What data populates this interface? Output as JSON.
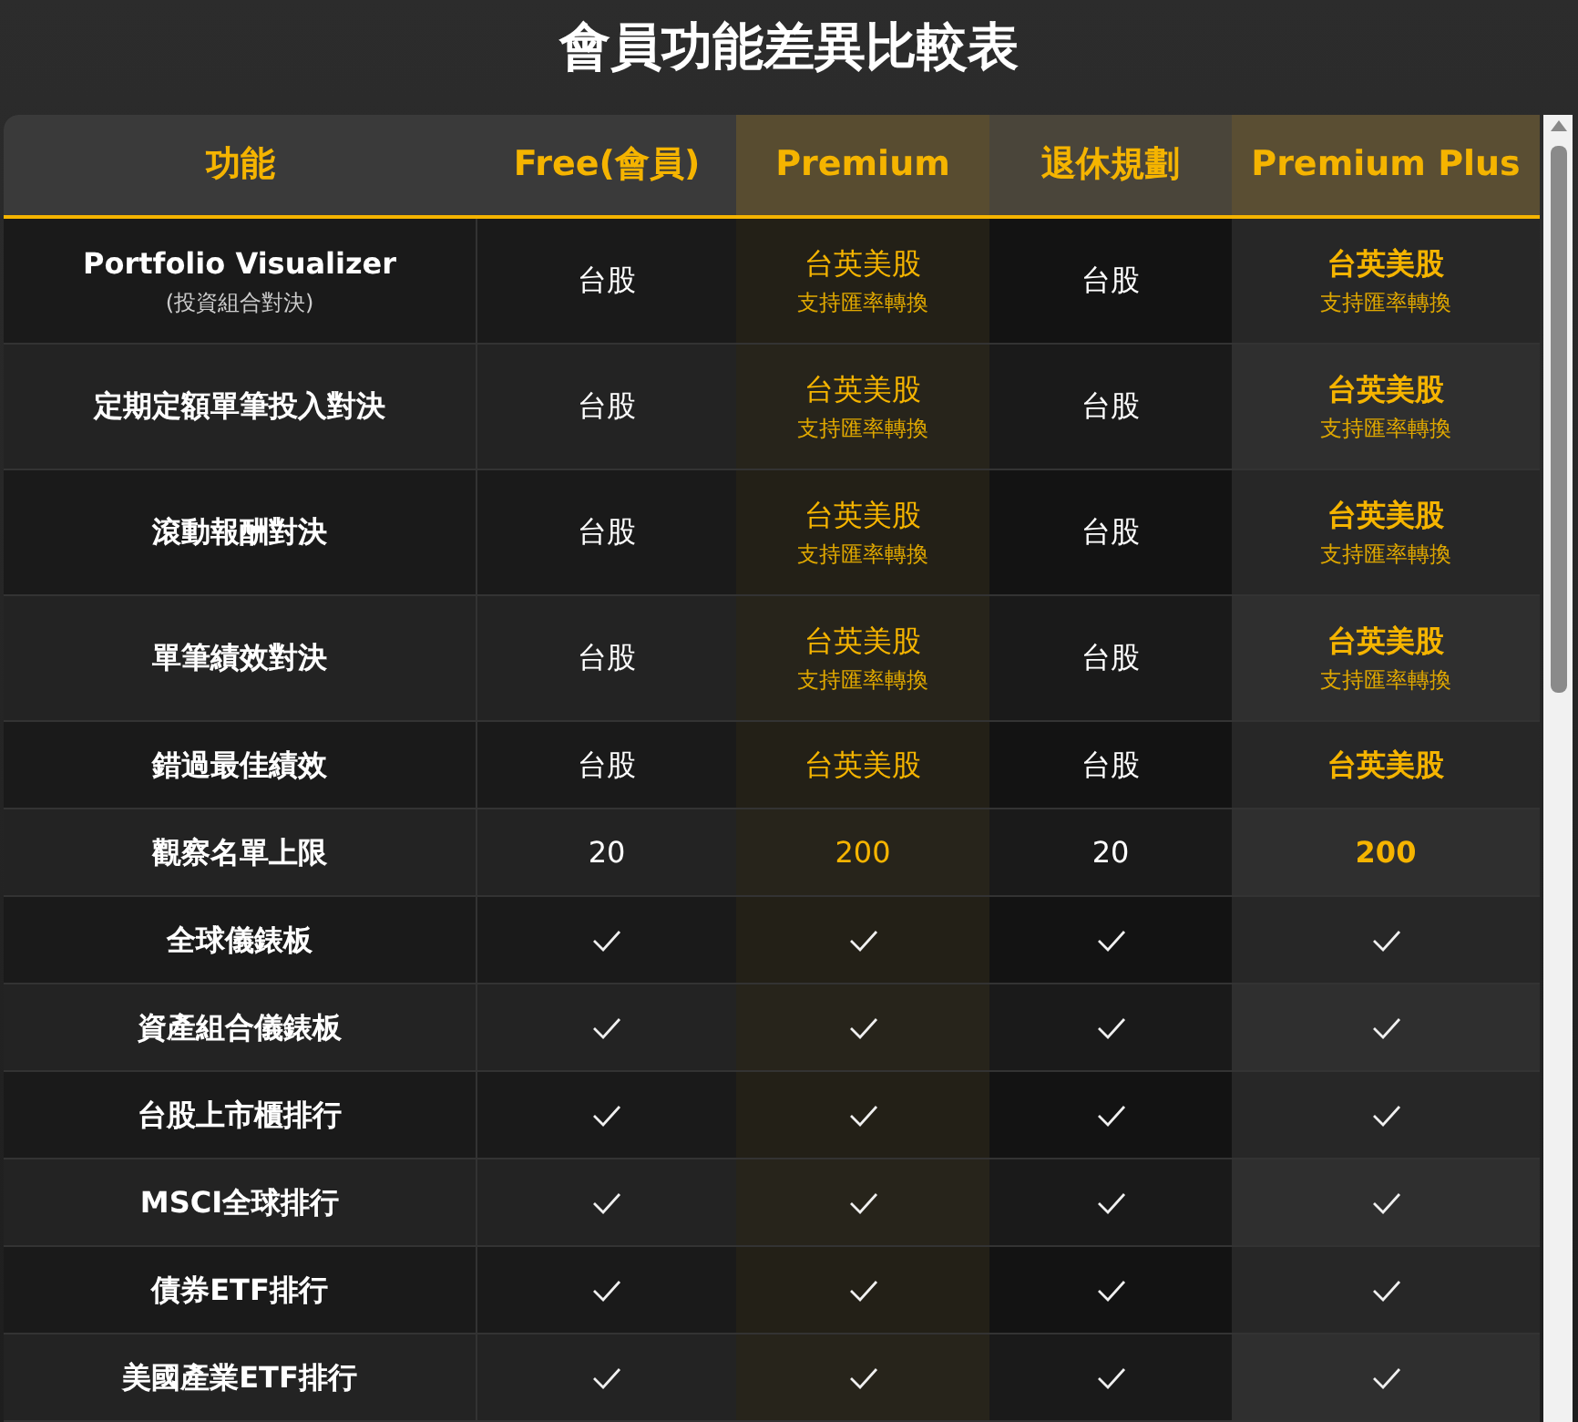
{
  "title": "會員功能差異比較表",
  "columns": [
    {
      "label": "功能",
      "kind": "plain"
    },
    {
      "label": "Free(會員)",
      "kind": "plain"
    },
    {
      "label": "Premium",
      "kind": "gold"
    },
    {
      "label": "退休規劃",
      "kind": "dim"
    },
    {
      "label": "Premium Plus",
      "kind": "light"
    }
  ],
  "rows": [
    {
      "feature": "Portfolio Visualizer",
      "subtitle": "(投資組合對決)",
      "cells": [
        {
          "kind": "plain",
          "text": "台股"
        },
        {
          "kind": "accent",
          "text": "台英美股",
          "note": "支持匯率轉換"
        },
        {
          "kind": "plain",
          "text": "台股"
        },
        {
          "kind": "accent_bold",
          "text": "台英美股",
          "note": "支持匯率轉換"
        }
      ]
    },
    {
      "feature": "定期定額單筆投入對決",
      "cells": [
        {
          "kind": "plain",
          "text": "台股"
        },
        {
          "kind": "accent",
          "text": "台英美股",
          "note": "支持匯率轉換"
        },
        {
          "kind": "plain",
          "text": "台股"
        },
        {
          "kind": "accent_bold",
          "text": "台英美股",
          "note": "支持匯率轉換"
        }
      ]
    },
    {
      "feature": "滾動報酬對決",
      "cells": [
        {
          "kind": "plain",
          "text": "台股"
        },
        {
          "kind": "accent",
          "text": "台英美股",
          "note": "支持匯率轉換"
        },
        {
          "kind": "plain",
          "text": "台股"
        },
        {
          "kind": "accent_bold",
          "text": "台英美股",
          "note": "支持匯率轉換"
        }
      ]
    },
    {
      "feature": "單筆績效對決",
      "cells": [
        {
          "kind": "plain",
          "text": "台股"
        },
        {
          "kind": "accent",
          "text": "台英美股",
          "note": "支持匯率轉換"
        },
        {
          "kind": "plain",
          "text": "台股"
        },
        {
          "kind": "accent_bold",
          "text": "台英美股",
          "note": "支持匯率轉換"
        }
      ]
    },
    {
      "feature": "錯過最佳績效",
      "cells": [
        {
          "kind": "plain",
          "text": "台股"
        },
        {
          "kind": "accent",
          "text": "台英美股"
        },
        {
          "kind": "plain",
          "text": "台股"
        },
        {
          "kind": "accent_bold",
          "text": "台英美股"
        }
      ]
    },
    {
      "feature": "觀察名單上限",
      "cells": [
        {
          "kind": "plain",
          "text": "20"
        },
        {
          "kind": "accent",
          "text": "200"
        },
        {
          "kind": "plain",
          "text": "20"
        },
        {
          "kind": "accent_bold",
          "text": "200"
        }
      ]
    },
    {
      "feature": "全球儀錶板",
      "cells": [
        {
          "kind": "check"
        },
        {
          "kind": "check"
        },
        {
          "kind": "check"
        },
        {
          "kind": "check"
        }
      ]
    },
    {
      "feature": "資產組合儀錶板",
      "cells": [
        {
          "kind": "check"
        },
        {
          "kind": "check"
        },
        {
          "kind": "check"
        },
        {
          "kind": "check"
        }
      ]
    },
    {
      "feature": "台股上市櫃排行",
      "cells": [
        {
          "kind": "check"
        },
        {
          "kind": "check"
        },
        {
          "kind": "check"
        },
        {
          "kind": "check"
        }
      ]
    },
    {
      "feature": "MSCI全球排行",
      "cells": [
        {
          "kind": "check"
        },
        {
          "kind": "check"
        },
        {
          "kind": "check"
        },
        {
          "kind": "check"
        }
      ]
    },
    {
      "feature": "債券ETF排行",
      "cells": [
        {
          "kind": "check"
        },
        {
          "kind": "check"
        },
        {
          "kind": "check"
        },
        {
          "kind": "check"
        }
      ]
    },
    {
      "feature": "美國產業ETF排行",
      "cells": [
        {
          "kind": "check"
        },
        {
          "kind": "check"
        },
        {
          "kind": "check"
        },
        {
          "kind": "check"
        }
      ]
    }
  ]
}
